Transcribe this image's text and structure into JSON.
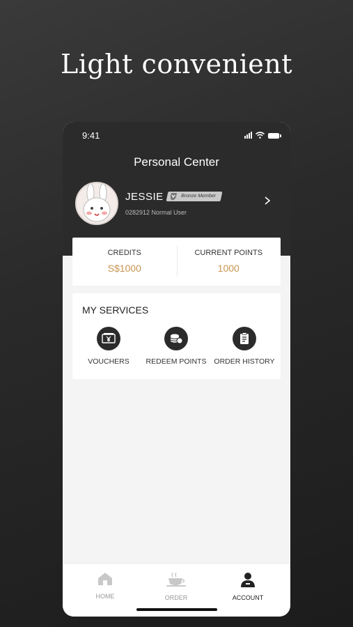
{
  "promo": {
    "headline": "Light convenient"
  },
  "status_bar": {
    "time": "9:41"
  },
  "header": {
    "title": "Personal Center"
  },
  "profile": {
    "name": "JESSIE",
    "badge": "Bronze Member",
    "sub_info": "0282912 Normal User"
  },
  "balances": {
    "credits_label": "CREDITS",
    "credits_value": "S$1000",
    "points_label": "CURRENT POINTS",
    "points_value": "1000"
  },
  "services": {
    "title": "MY SERVICES",
    "items": [
      {
        "label": "VOUCHERS",
        "icon": "voucher-icon"
      },
      {
        "label": "REDEEM POINTS",
        "icon": "coins-icon"
      },
      {
        "label": "ORDER HISTORY",
        "icon": "clipboard-icon"
      }
    ]
  },
  "tabbar": {
    "items": [
      {
        "label": "HOME",
        "icon": "home-icon",
        "active": false
      },
      {
        "label": "ORDER",
        "icon": "coffee-cup-icon",
        "active": false
      },
      {
        "label": "ACCOUNT",
        "icon": "user-icon",
        "active": true
      }
    ]
  },
  "colors": {
    "accent": "#c9944f",
    "dark": "#2b2b2b"
  }
}
